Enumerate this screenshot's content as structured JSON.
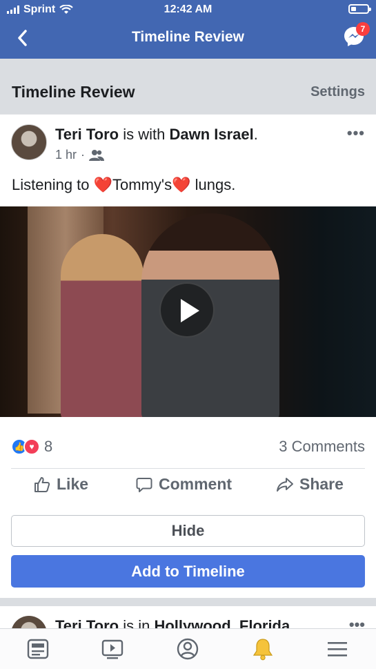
{
  "status_bar": {
    "carrier": "Sprint",
    "time": "12:42 AM"
  },
  "nav": {
    "title": "Timeline Review",
    "messenger_badge": "7"
  },
  "review_header": {
    "title": "Timeline Review",
    "settings_label": "Settings"
  },
  "post": {
    "author": "Teri Toro",
    "with_text": "is with",
    "tagged": "Dawn Israel",
    "period": ".",
    "time": "1 hr",
    "dot": "·",
    "text_before": "Listening to ",
    "heart": "❤️",
    "text_mid": "Tommy's",
    "text_after": " lungs.",
    "reaction_count": "8",
    "comments_label": "3 Comments"
  },
  "actions": {
    "like": "Like",
    "comment": "Comment",
    "share": "Share"
  },
  "buttons": {
    "hide": "Hide",
    "add_to_timeline": "Add to Timeline"
  },
  "post2": {
    "author": "Teri Toro",
    "in_text": "is in",
    "location": "Hollywood, Florida"
  },
  "colors": {
    "brand_blue": "#4267b2",
    "button_blue": "#4a76e0",
    "badge_red": "#fa3e3e",
    "bell_yellow": "#f5c33b"
  },
  "icons": [
    "signal-icon",
    "wifi-icon",
    "battery-icon",
    "back-chevron-icon",
    "messenger-icon",
    "group-privacy-icon",
    "more-dots-icon",
    "play-icon",
    "like-reaction-icon",
    "love-reaction-icon",
    "thumbs-up-icon",
    "comment-bubble-icon",
    "share-arrow-icon",
    "news-feed-icon",
    "watch-icon",
    "profile-icon",
    "bell-icon",
    "menu-icon"
  ]
}
